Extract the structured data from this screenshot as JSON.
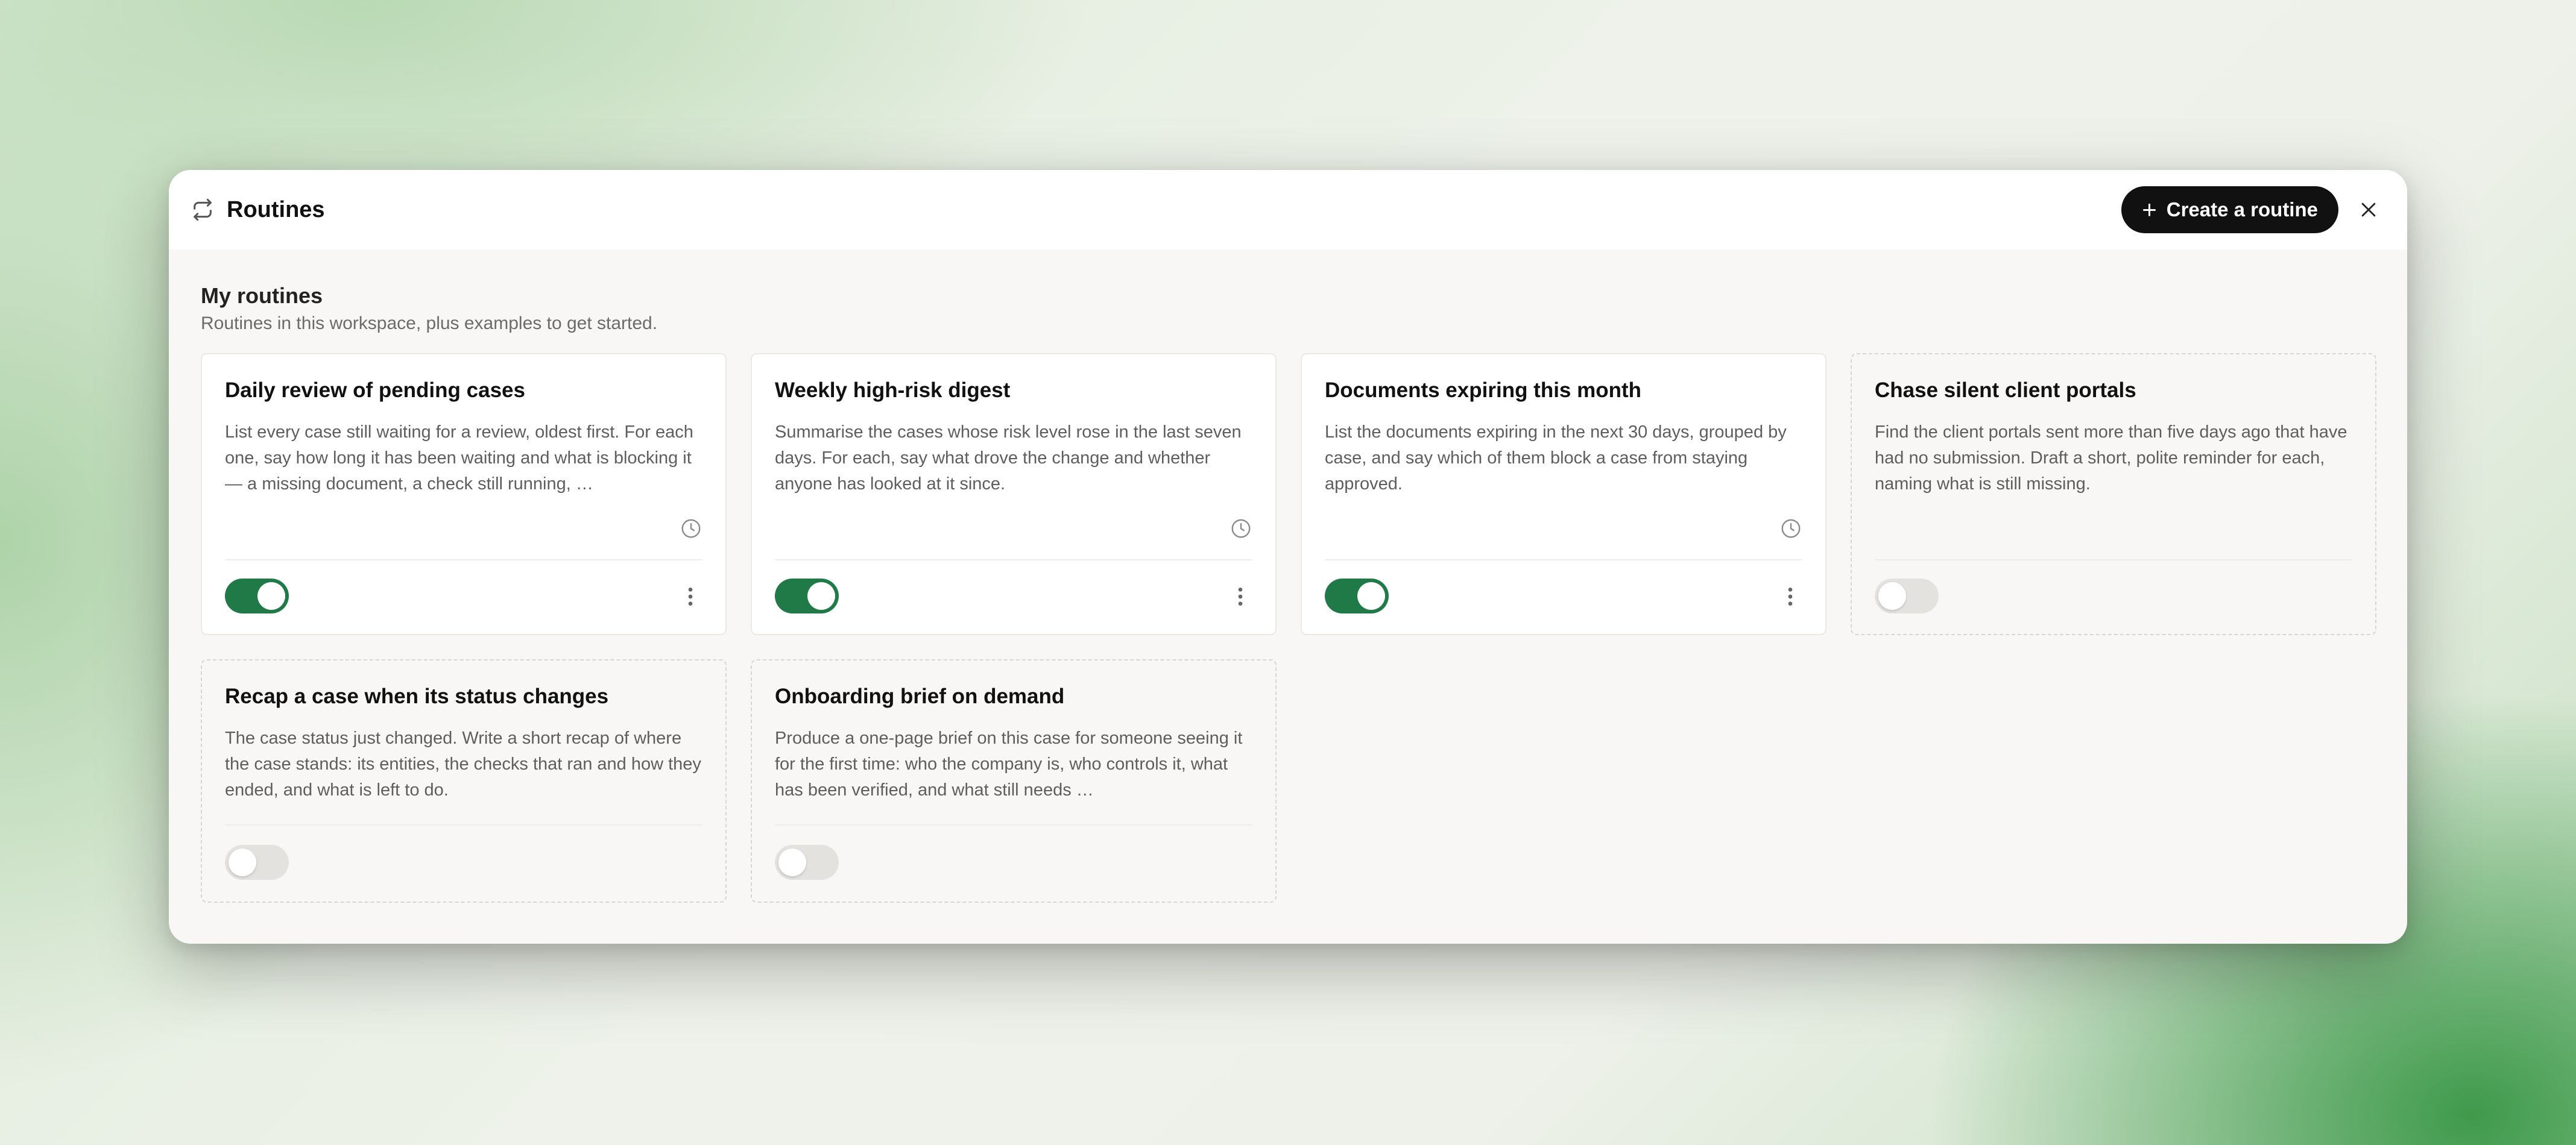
{
  "header": {
    "title": "Routines",
    "create_label": "Create a routine",
    "header_icon": "repeat-icon",
    "close_icon": "close-icon"
  },
  "section": {
    "title": "My routines",
    "subtitle": "Routines in this workspace, plus examples to get started."
  },
  "routines": [
    {
      "title": "Daily review of pending cases",
      "description": "List every case still waiting for a review, oldest first. For each one, say how long it has been waiting and what is blocking it — a missing document, a check still running, …",
      "enabled": true,
      "scheduled": true,
      "example": false
    },
    {
      "title": "Weekly high-risk digest",
      "description": "Summarise the cases whose risk level rose in the last seven days. For each, say what drove the change and whether anyone has looked at it since.",
      "enabled": true,
      "scheduled": true,
      "example": false
    },
    {
      "title": "Documents expiring this month",
      "description": "List the documents expiring in the next 30 days, grouped by case, and say which of them block a case from staying approved.",
      "enabled": true,
      "scheduled": true,
      "example": false
    },
    {
      "title": "Chase silent client portals",
      "description": "Find the client portals sent more than five days ago that have had no submission. Draft a short, polite reminder for each, naming what is still missing.",
      "enabled": false,
      "scheduled": false,
      "example": true
    },
    {
      "title": "Recap a case when its status changes",
      "description": "The case status just changed. Write a short recap of where the case stands: its entities, the checks that ran and how they ended, and what is left to do.",
      "enabled": false,
      "scheduled": false,
      "example": true
    },
    {
      "title": "Onboarding brief on demand",
      "description": "Produce a one-page brief on this case for someone seeing it for the first time: who the company is, who controls it, what has been verified, and what still needs …",
      "enabled": false,
      "scheduled": false,
      "example": true
    }
  ],
  "colors": {
    "toggle_on": "#1f7a48",
    "toggle_off": "#e4e2df",
    "primary_button": "#111111"
  }
}
